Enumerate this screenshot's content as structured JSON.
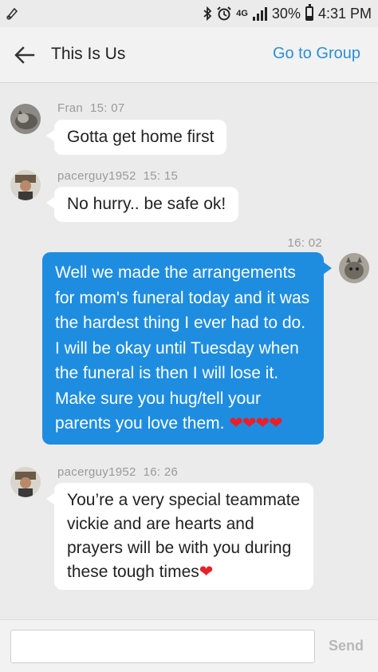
{
  "status_bar": {
    "signal_label": "4G",
    "battery_percent": "30%",
    "time": "4:31 PM"
  },
  "header": {
    "title": "This Is Us",
    "group_link": "Go to Group"
  },
  "messages": [
    {
      "sender": "Fran",
      "time": "15: 07",
      "text": "Gotta get home first"
    },
    {
      "sender": "pacerguy1952",
      "time": "15: 15",
      "text": "No hurry.. be safe ok!"
    },
    {
      "sender": "",
      "time": "16: 02",
      "text": "Well we made the arrangements for mom's funeral today and it was the hardest thing I ever had to do. I will be okay until Tuesday when the funeral is then I will lose it. Make sure you hug/tell your parents you love them. ",
      "hearts": "❤❤❤❤"
    },
    {
      "sender": "pacerguy1952",
      "time": "16: 26",
      "text": "You’re a very special teammate vickie and are hearts and prayers will be with you during these tough times",
      "hearts": "❤"
    }
  ],
  "composer": {
    "placeholder": "",
    "send_label": "Send"
  },
  "colors": {
    "accent": "#2b8fd6",
    "outgoing_bubble": "#1e8de0",
    "heart": "#e8202a"
  }
}
